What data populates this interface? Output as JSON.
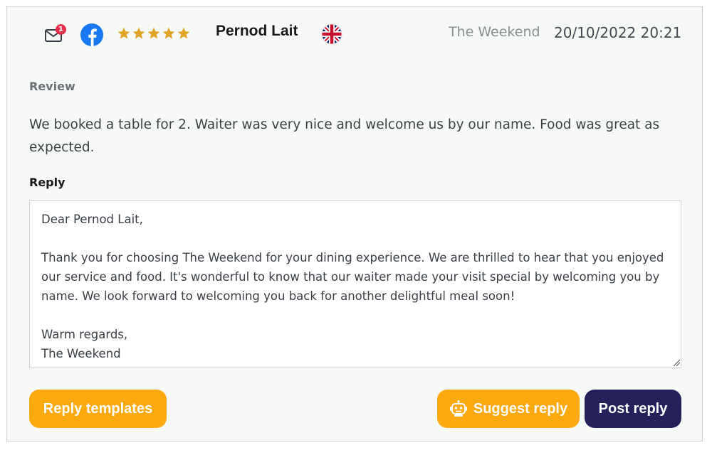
{
  "header": {
    "mail_badge_count": "1",
    "rating_stars": 5,
    "reviewer_name": "Pernod Lait",
    "business_name": "The Weekend",
    "datetime": "20/10/2022 20:21",
    "icons": [
      "mail-icon",
      "facebook-icon",
      "star-icon",
      "uk-flag-icon"
    ]
  },
  "review": {
    "label": "Review",
    "text": "We booked a table for 2. Waiter was very nice and welcome us by our name. Food was great as expected."
  },
  "reply": {
    "label": "Reply",
    "text": "Dear Pernod Lait,\n\nThank you for choosing The Weekend for your dining experience. We are thrilled to hear that you enjoyed our service and food. It's wonderful to know that our waiter made your visit special by welcoming you by name. We look forward to welcoming you back for another delightful meal soon!\n\nWarm regards,\nThe Weekend"
  },
  "actions": {
    "templates_label": "Reply templates",
    "suggest_label": "Suggest reply",
    "post_label": "Post reply"
  },
  "colors": {
    "accent_orange": "#fca90f",
    "post_button": "#24205a",
    "star_gold": "#e0a526",
    "facebook_blue": "#1877f2",
    "badge_red": "#e8304e"
  }
}
